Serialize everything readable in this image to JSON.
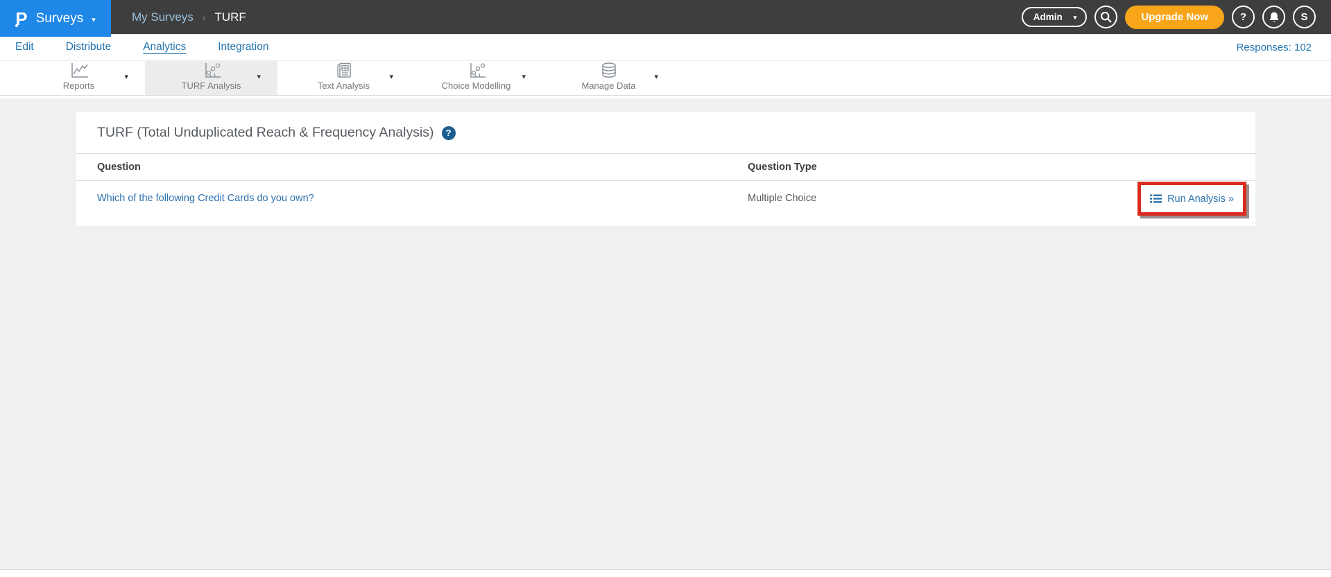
{
  "topbar": {
    "logo_letter": "P",
    "product_label": "Surveys",
    "caret_glyph": "▾",
    "breadcrumb": {
      "parent": "My Surveys",
      "separator": "›",
      "current": "TURF"
    },
    "admin": {
      "label": "Admin",
      "caret_glyph": "▾"
    },
    "upgrade_label": "Upgrade Now",
    "help_glyph": "?",
    "avatar_letter": "S"
  },
  "subnav": {
    "items": [
      {
        "label": "Edit",
        "active": false
      },
      {
        "label": "Distribute",
        "active": false
      },
      {
        "label": "Analytics",
        "active": true
      },
      {
        "label": "Integration",
        "active": false
      }
    ],
    "responses_label": "Responses: 102"
  },
  "toolbar": {
    "caret_glyph": "▾",
    "items": [
      {
        "label": "Reports",
        "icon": "line-chart-icon",
        "active": false
      },
      {
        "label": "TURF Analysis",
        "icon": "scatter-chart-icon",
        "active": true
      },
      {
        "label": "Text Analysis",
        "icon": "report-doc-icon",
        "active": false
      },
      {
        "label": "Choice Modelling",
        "icon": "scatter-chart-icon",
        "active": false
      },
      {
        "label": "Manage Data",
        "icon": "database-icon",
        "active": false
      }
    ]
  },
  "main": {
    "title": "TURF (Total Unduplicated Reach & Frequency Analysis)",
    "help_glyph": "?",
    "table": {
      "col_question": "Question",
      "col_type": "Question Type",
      "row": {
        "question": "Which of the following Credit Cards do you own?",
        "type": "Multiple Choice",
        "action": "Run Analysis »"
      }
    }
  },
  "colors": {
    "topbar_dark": "#3e3e3e",
    "brand_blue": "#1f87e8",
    "accent_orange": "#f9a51a",
    "link_blue": "#2273ae",
    "highlight_red": "#d92b1f",
    "page_bg": "#f0f0f1",
    "active_tab_bg": "#ececec",
    "help_circle_blue": "#1c5d90"
  }
}
